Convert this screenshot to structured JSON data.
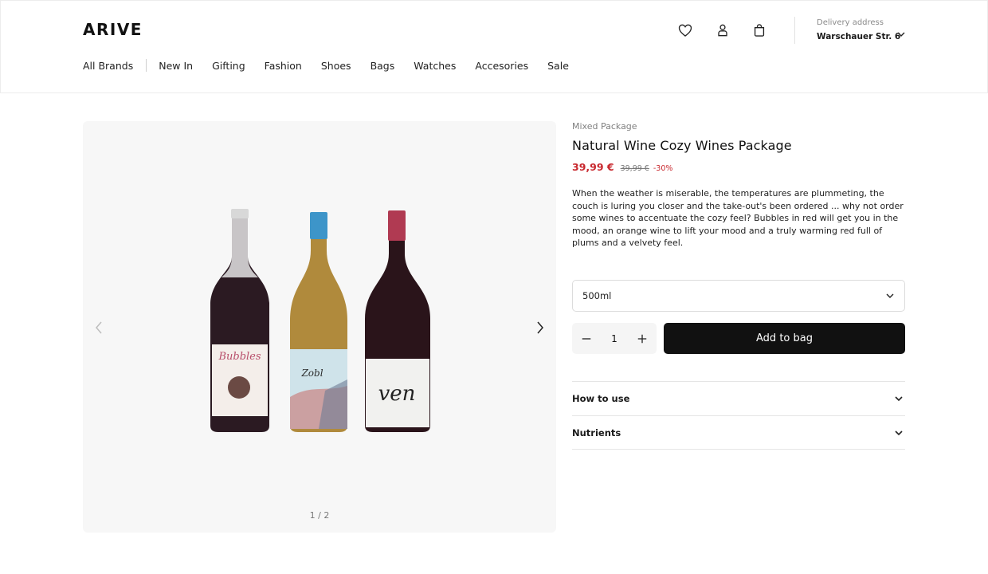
{
  "header": {
    "logo": "ARIVE",
    "nav": [
      "All Brands",
      "New In",
      "Gifting",
      "Fashion",
      "Shoes",
      "Bags",
      "Watches",
      "Accesories",
      "Sale"
    ],
    "icons": [
      "heart-icon",
      "user-icon",
      "bag-icon"
    ],
    "delivery_label": "Delivery address",
    "delivery_value": "Warschauer Str. 6"
  },
  "gallery": {
    "counter": "1 / 2",
    "bottle_labels": [
      "Bubbles",
      "Zobl",
      "ven"
    ]
  },
  "product": {
    "category": "Mixed Package",
    "title": "Natural Wine Cozy Wines Package",
    "price": "39,99 €",
    "old_price": "39,99 €",
    "discount": "-30%",
    "description": "When the weather is miserable, the temperatures are plummeting, the couch is luring you closer and the take-out's been ordered ... why not order some wines to accentuate the cozy feel? Bubbles in red will get you in the mood, an orange wine to lift your mood and a truly warming red full of plums and a velvety feel.",
    "size_selected": "500ml",
    "quantity": "1",
    "add_label": "Add to bag",
    "accordions": [
      "How to use",
      "Nutrients"
    ]
  },
  "colors": {
    "accent_price": "#c8282e",
    "button_bg": "#111111",
    "gallery_bg": "#f7f7f7"
  }
}
